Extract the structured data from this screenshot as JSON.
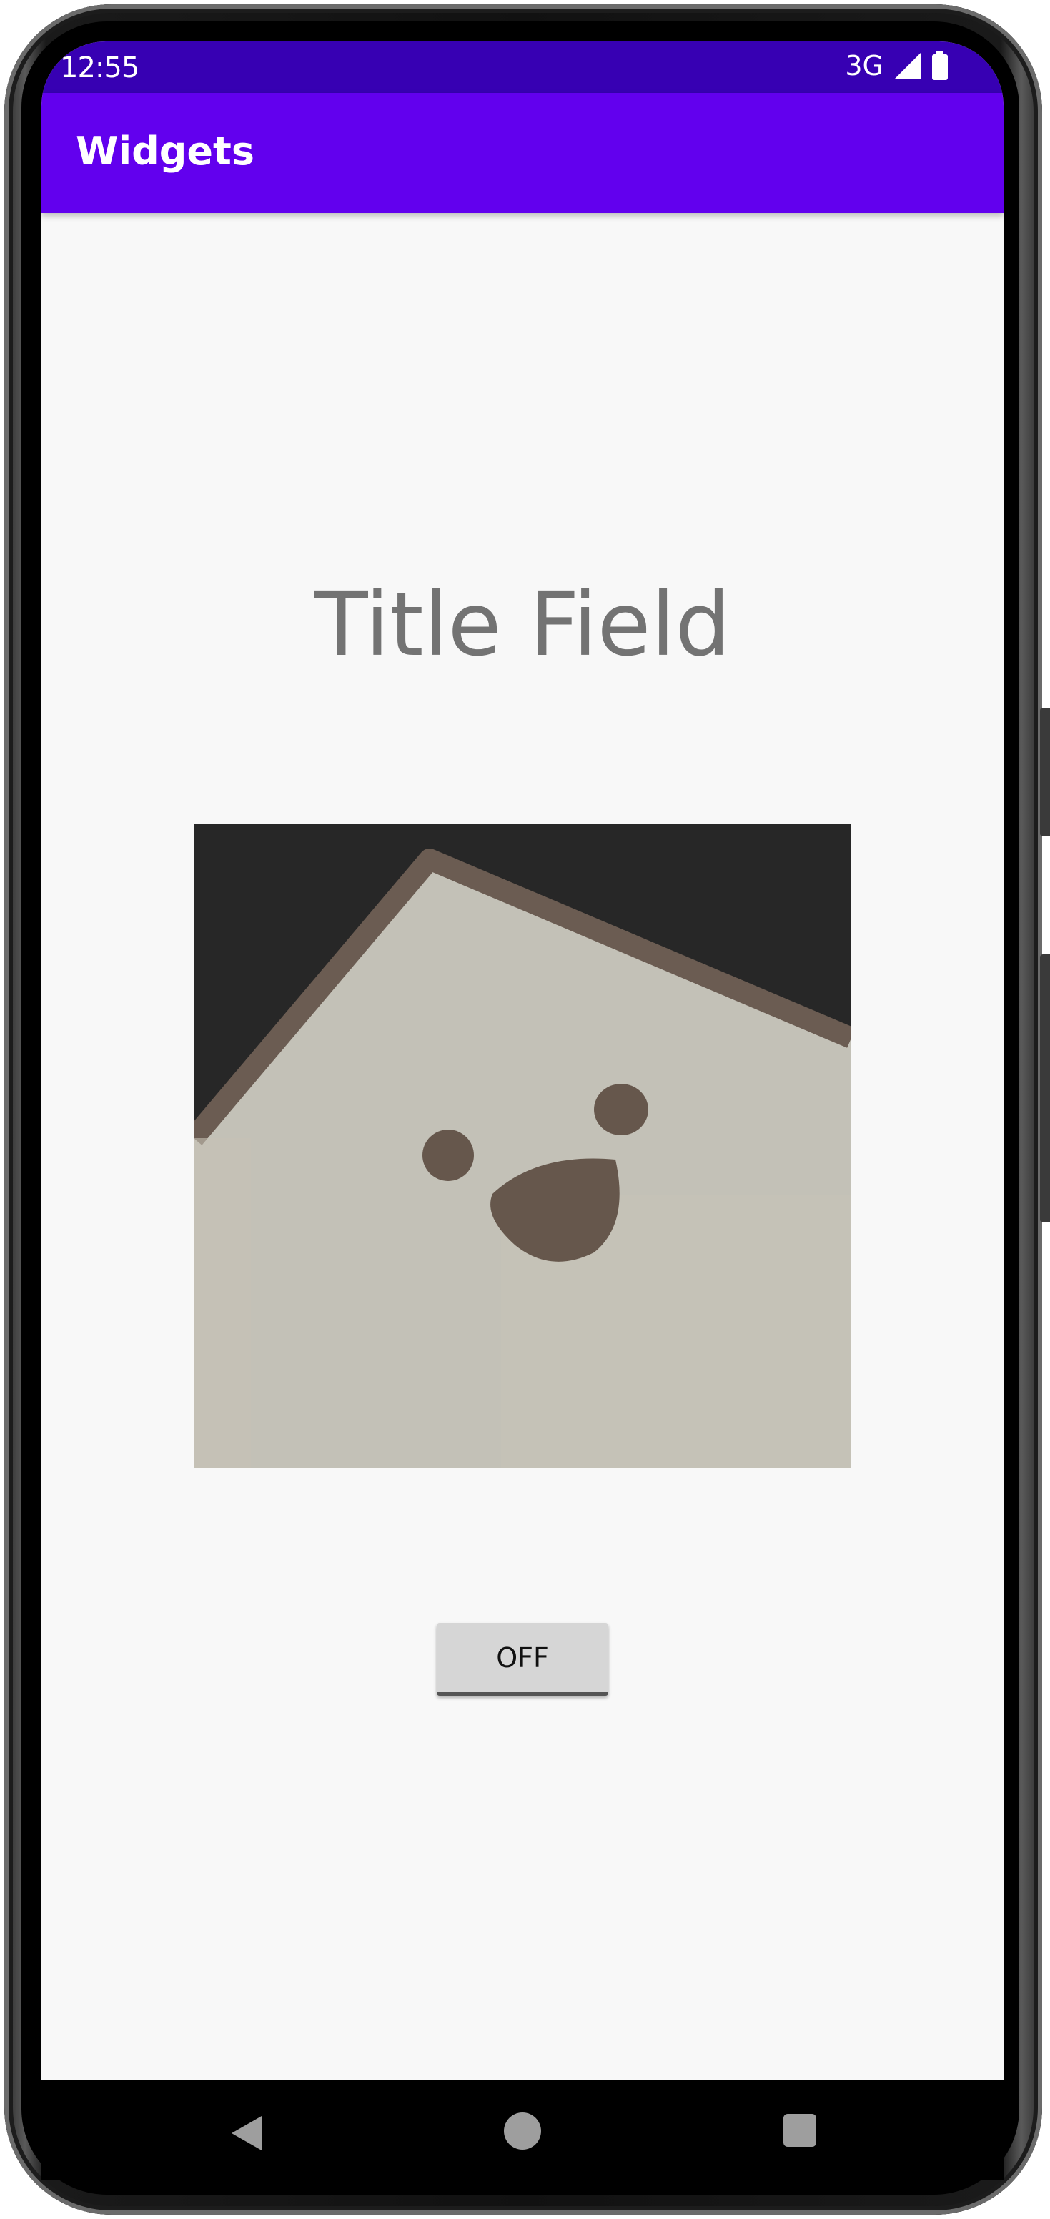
{
  "status_bar": {
    "time": "12:55",
    "network": "3G",
    "icons": [
      "signal-icon",
      "battery-icon"
    ],
    "color": "#3700b3"
  },
  "app_bar": {
    "title": "Widgets",
    "color": "#6200ee"
  },
  "main": {
    "title_field": "Title Field",
    "image": "cartoon-ghost-face",
    "toggle_button": {
      "label": "OFF",
      "state": "off"
    }
  },
  "nav_bar": {
    "icons": [
      "back-icon",
      "home-icon",
      "recents-icon"
    ]
  }
}
